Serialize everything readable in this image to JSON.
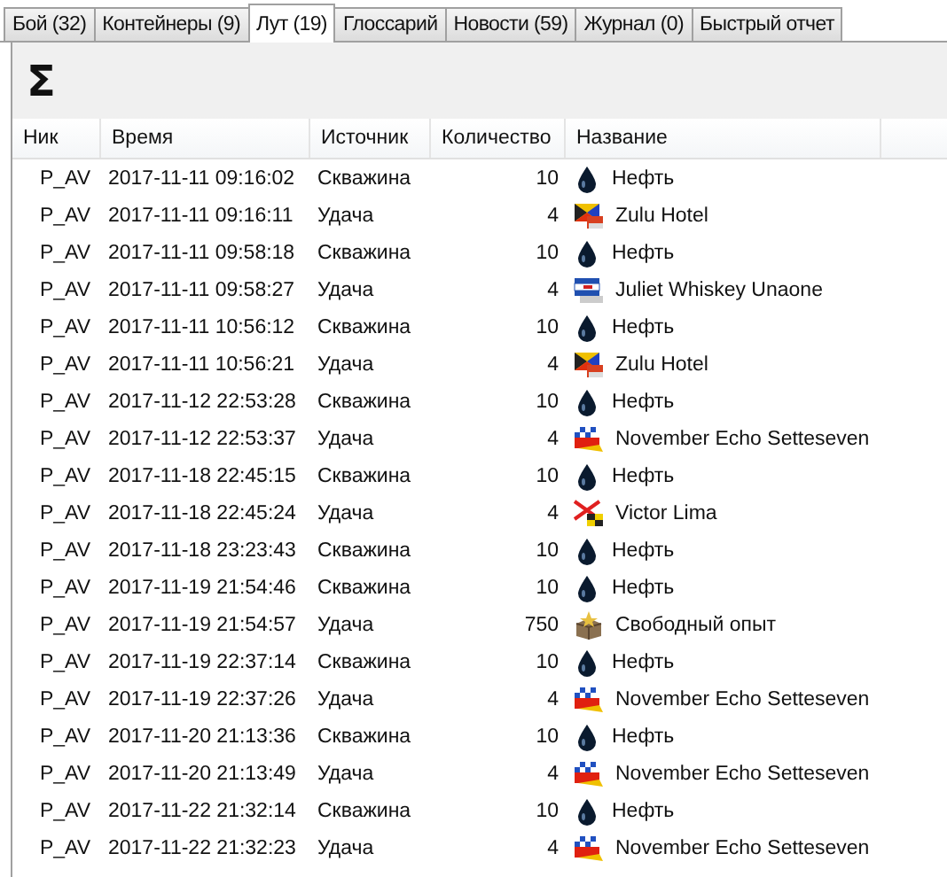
{
  "tabs": [
    {
      "label": "Бой (32)",
      "selected": false
    },
    {
      "label": "Контейнеры (9)",
      "selected": false
    },
    {
      "label": "Лут (19)",
      "selected": true
    },
    {
      "label": "Глоссарий",
      "selected": false
    },
    {
      "label": "Новости (59)",
      "selected": false
    },
    {
      "label": "Журнал (0)",
      "selected": false
    },
    {
      "label": "Быстрый отчет",
      "selected": false
    }
  ],
  "toolbar": {
    "sum_button": "Σ"
  },
  "table": {
    "columns": [
      "Ник",
      "Время",
      "Источник",
      "Количество",
      "Название"
    ],
    "rows": [
      {
        "nick": "P_AV",
        "time": "2017-11-11 09:16:02",
        "source": "Скважина",
        "amount": "10",
        "kind": "oil",
        "name": "Нефть"
      },
      {
        "nick": "P_AV",
        "time": "2017-11-11 09:16:11",
        "source": "Удача",
        "amount": "4",
        "kind": "flag-zh",
        "name": "Zulu Hotel"
      },
      {
        "nick": "P_AV",
        "time": "2017-11-11 09:58:18",
        "source": "Скважина",
        "amount": "10",
        "kind": "oil",
        "name": "Нефть"
      },
      {
        "nick": "P_AV",
        "time": "2017-11-11 09:58:27",
        "source": "Удача",
        "amount": "4",
        "kind": "flag-jwu",
        "name": "Juliet Whiskey Unaone"
      },
      {
        "nick": "P_AV",
        "time": "2017-11-11 10:56:12",
        "source": "Скважина",
        "amount": "10",
        "kind": "oil",
        "name": "Нефть"
      },
      {
        "nick": "P_AV",
        "time": "2017-11-11 10:56:21",
        "source": "Удача",
        "amount": "4",
        "kind": "flag-zh",
        "name": "Zulu Hotel"
      },
      {
        "nick": "P_AV",
        "time": "2017-11-12 22:53:28",
        "source": "Скважина",
        "amount": "10",
        "kind": "oil",
        "name": "Нефть"
      },
      {
        "nick": "P_AV",
        "time": "2017-11-12 22:53:37",
        "source": "Удача",
        "amount": "4",
        "kind": "flag-nes",
        "name": "November Echo Setteseven"
      },
      {
        "nick": "P_AV",
        "time": "2017-11-18 22:45:15",
        "source": "Скважина",
        "amount": "10",
        "kind": "oil",
        "name": "Нефть"
      },
      {
        "nick": "P_AV",
        "time": "2017-11-18 22:45:24",
        "source": "Удача",
        "amount": "4",
        "kind": "flag-vl",
        "name": "Victor Lima"
      },
      {
        "nick": "P_AV",
        "time": "2017-11-18 23:23:43",
        "source": "Скважина",
        "amount": "10",
        "kind": "oil",
        "name": "Нефть"
      },
      {
        "nick": "P_AV",
        "time": "2017-11-19 21:54:46",
        "source": "Скважина",
        "amount": "10",
        "kind": "oil",
        "name": "Нефть"
      },
      {
        "nick": "P_AV",
        "time": "2017-11-19 21:54:57",
        "source": "Удача",
        "amount": "750",
        "kind": "xp",
        "name": "Свободный опыт"
      },
      {
        "nick": "P_AV",
        "time": "2017-11-19 22:37:14",
        "source": "Скважина",
        "amount": "10",
        "kind": "oil",
        "name": "Нефть"
      },
      {
        "nick": "P_AV",
        "time": "2017-11-19 22:37:26",
        "source": "Удача",
        "amount": "4",
        "kind": "flag-nes",
        "name": "November Echo Setteseven"
      },
      {
        "nick": "P_AV",
        "time": "2017-11-20 21:13:36",
        "source": "Скважина",
        "amount": "10",
        "kind": "oil",
        "name": "Нефть"
      },
      {
        "nick": "P_AV",
        "time": "2017-11-20 21:13:49",
        "source": "Удача",
        "amount": "4",
        "kind": "flag-nes",
        "name": "November Echo Setteseven"
      },
      {
        "nick": "P_AV",
        "time": "2017-11-22 21:32:14",
        "source": "Скважина",
        "amount": "10",
        "kind": "oil",
        "name": "Нефть"
      },
      {
        "nick": "P_AV",
        "time": "2017-11-22 21:32:23",
        "source": "Удача",
        "amount": "4",
        "kind": "flag-nes",
        "name": "November Echo Setteseven"
      }
    ]
  }
}
